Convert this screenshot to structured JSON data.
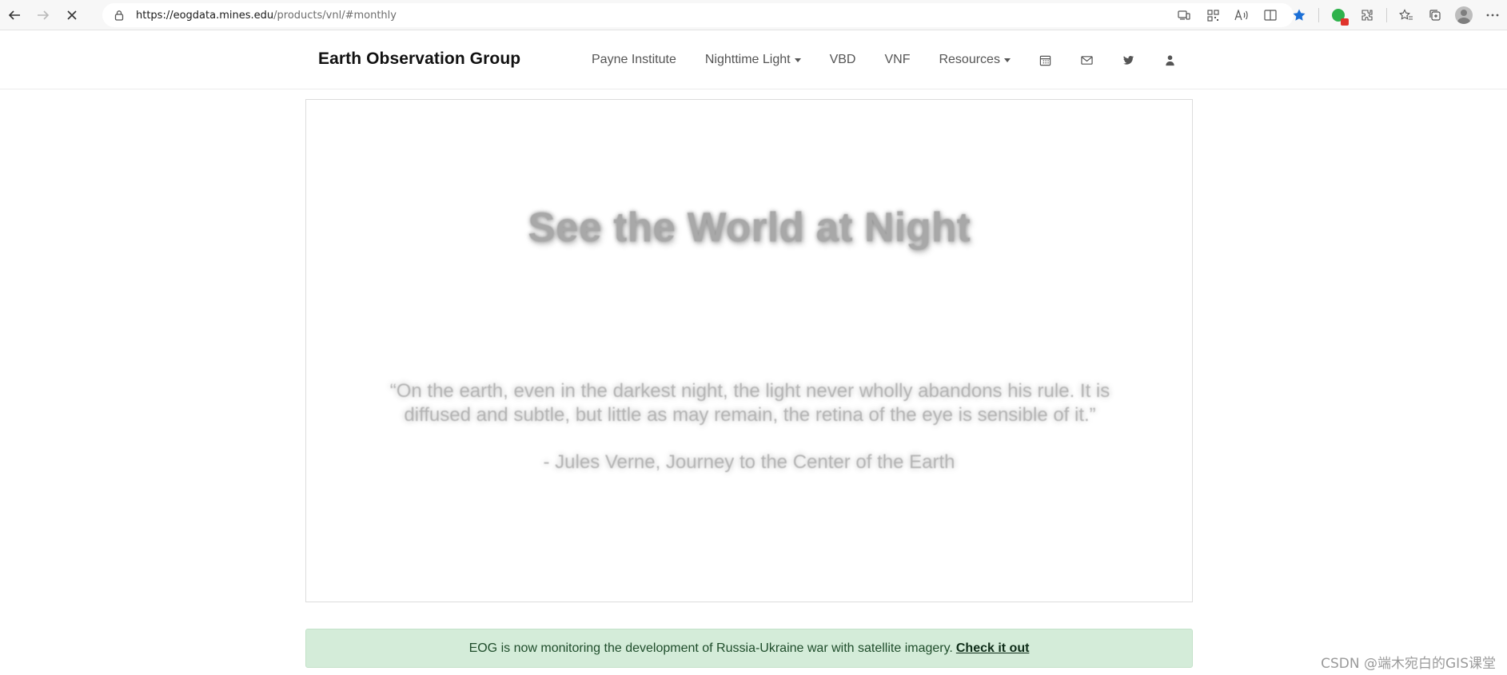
{
  "browser": {
    "url_host": "https://eogdata.mines.edu",
    "url_path": "/products/vnl/#monthly"
  },
  "site": {
    "brand": "Earth Observation Group",
    "nav": [
      {
        "label": "Payne Institute",
        "dropdown": false
      },
      {
        "label": "Nighttime Light",
        "dropdown": true
      },
      {
        "label": "VBD",
        "dropdown": false
      },
      {
        "label": "VNF",
        "dropdown": false
      },
      {
        "label": "Resources",
        "dropdown": true
      }
    ],
    "nav_icons": [
      "calendar-icon",
      "envelope-icon",
      "twitter-icon",
      "user-icon"
    ]
  },
  "hero": {
    "title": "See the World at Night",
    "quote": "“On the earth, even in the darkest night, the light never wholly abandons his rule. It is diffused and subtle, but little as may remain, the retina of the eye is sensible of it.”",
    "attribution": "- Jules Verne, Journey to the Center of the Earth"
  },
  "alert": {
    "text": "EOG is now monitoring the development of Russia-Ukraine war with satellite imagery.",
    "link_label": "Check it out",
    "bg_color": "#d4ecd9"
  },
  "watermark": "CSDN @端木宛白的GIS课堂",
  "colors": {
    "star": "#1c6fd6",
    "title_gray": "#a8a8a8"
  }
}
